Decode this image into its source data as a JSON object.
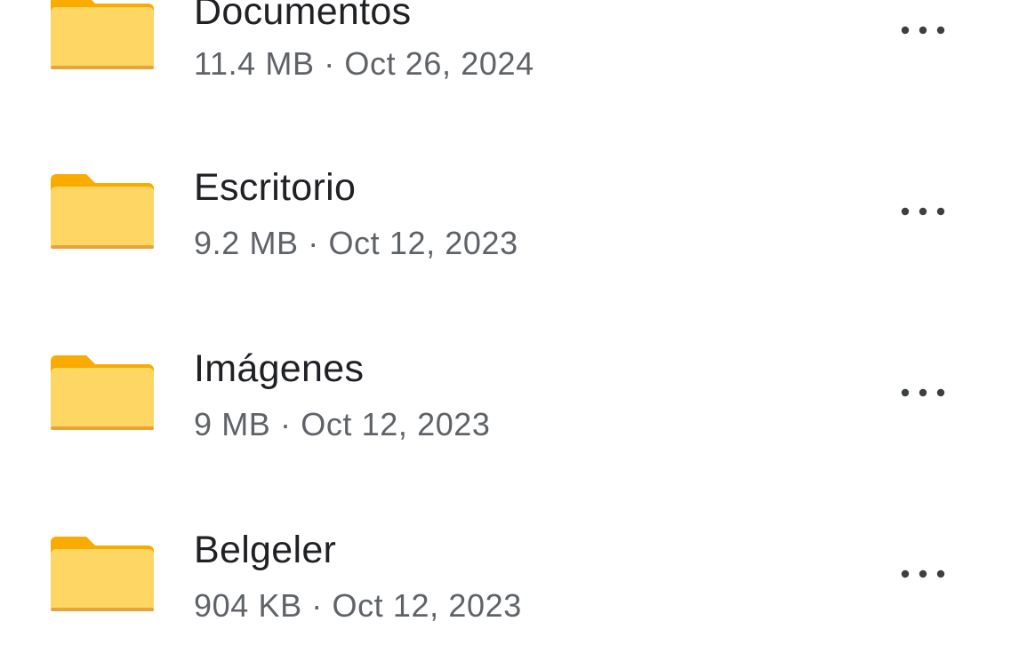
{
  "colors": {
    "folder_body": "#FDD663",
    "folder_tab": "#F9AB00",
    "folder_shade": "#E8A23C",
    "name_text": "#202124",
    "meta_text": "#5f6368",
    "more_icon": "#3c4043"
  },
  "icons": {
    "folder": "folder-icon",
    "more": "more-horizontal-icon"
  },
  "folders": [
    {
      "name": "Documentos",
      "meta": "11.4 MB · Oct 26, 2024"
    },
    {
      "name": "Escritorio",
      "meta": "9.2 MB · Oct 12, 2023"
    },
    {
      "name": "Imágenes",
      "meta": "9 MB · Oct 12, 2023"
    },
    {
      "name": "Belgeler",
      "meta": "904 KB · Oct 12, 2023"
    }
  ]
}
